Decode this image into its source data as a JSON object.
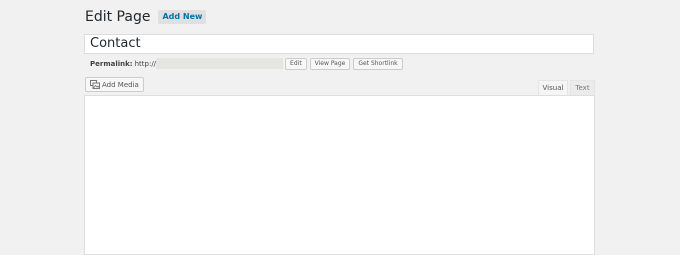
{
  "header": {
    "title": "Edit Page",
    "add_new_label": "Add New"
  },
  "title_field": {
    "value": "Contact"
  },
  "permalink": {
    "label": "Permalink:",
    "url_prefix": "http://",
    "edit_label": "Edit",
    "view_label": "View Page",
    "shortlink_label": "Get Shortlink"
  },
  "media": {
    "add_media_label": "Add Media",
    "icon": "add-media-icon"
  },
  "editor": {
    "tabs": [
      {
        "label": "Visual",
        "active": true
      },
      {
        "label": "Text",
        "active": false
      }
    ],
    "content": ""
  }
}
